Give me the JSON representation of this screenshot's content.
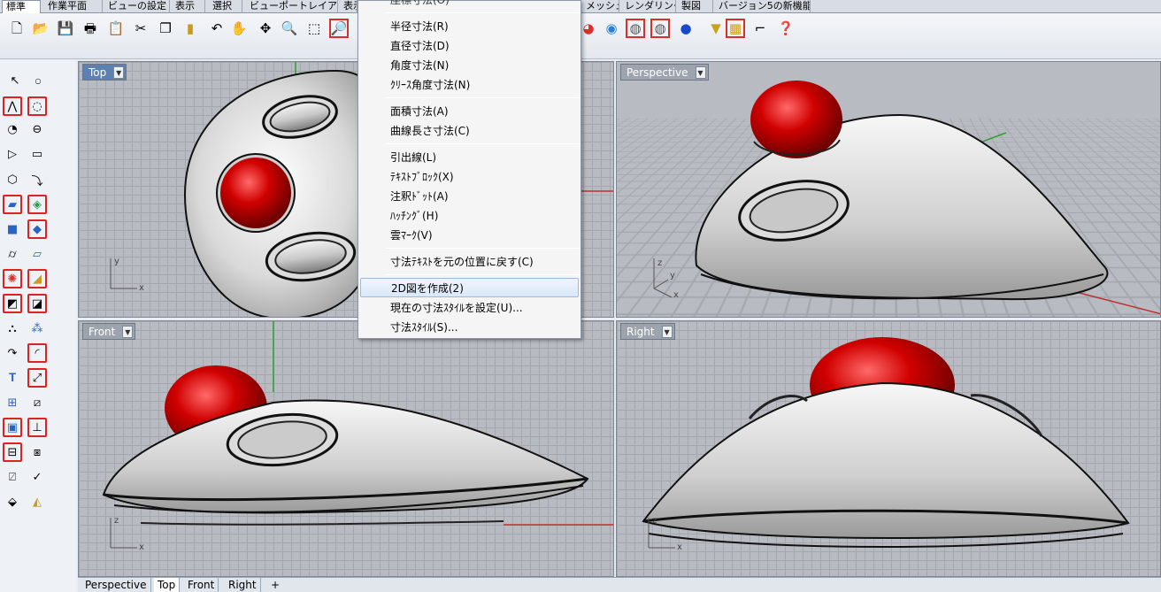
{
  "tabs": [
    "標準",
    "作業平面",
    "ビューの設定",
    "表示",
    "選択",
    "ビューポートレイアウト",
    "表示",
    "メッシュ",
    "レンダリング",
    "製図",
    "バージョン5の新機能"
  ],
  "active_tab": "標準",
  "toolbar_icons": [
    "new-file-icon",
    "open-folder-icon",
    "save-icon",
    "print-icon",
    "import-icon",
    "cut-icon",
    "copy-icon",
    "paste-icon",
    "undo-icon",
    "pan-hand-icon",
    "rotate-view-icon",
    "zoom-icon",
    "zoom-window-icon",
    "zoom-selected-icon"
  ],
  "toolbar_right_icons": [
    "render-ball-icon",
    "color-wheel-icon",
    "shaded-sphere-icon",
    "rendered-sphere-icon",
    "blue-sphere-icon",
    "light-icon",
    "grid-snap-icon",
    "osnap-icon",
    "help-icon"
  ],
  "menu": {
    "top_partial": "座標寸法(O)",
    "items": [
      {
        "label": "半径寸法(R)"
      },
      {
        "label": "直径寸法(D)"
      },
      {
        "label": "角度寸法(N)"
      },
      {
        "label": "ｸﾘｰｽ角度寸法(N)"
      },
      {
        "label": "面積寸法(A)"
      },
      {
        "label": "曲線長さ寸法(C)"
      },
      {
        "label": "引出線(L)"
      },
      {
        "label": "ﾃｷｽﾄﾌﾞﾛｯｸ(X)"
      },
      {
        "label": "注釈ﾄﾞｯﾄ(A)"
      },
      {
        "label": "ﾊｯﾁﾝｸﾞ(H)"
      },
      {
        "label": "雲ﾏｰｸ(V)"
      },
      {
        "label": "寸法ﾃｷｽﾄを元の位置に戻す(C)"
      },
      {
        "label": "2D図を作成(2)"
      },
      {
        "label": "現在の寸法ｽﾀｲﾙを設定(U)..."
      },
      {
        "label": "寸法ｽﾀｲﾙ(S)..."
      }
    ],
    "highlighted": "2D図を作成(2)"
  },
  "viewports": {
    "top": {
      "label": "Top",
      "active": true,
      "axes": [
        "y",
        "x"
      ]
    },
    "perspective": {
      "label": "Perspective",
      "active": false,
      "axes": [
        "z",
        "y",
        "x"
      ]
    },
    "front": {
      "label": "Front",
      "active": false,
      "axes": [
        "z",
        "x"
      ]
    },
    "right": {
      "label": "Right",
      "active": false,
      "axes": [
        "z",
        "x"
      ]
    }
  },
  "viewport_tabs": [
    "Perspective",
    "Top",
    "Front",
    "Right"
  ],
  "active_viewport_tab": "Top",
  "add_tab_symbol": "+",
  "colors": {
    "ball": "#c40000",
    "body": "#d4d4d4",
    "grid_bg": "#b8bcc2",
    "highlight": "#dbe8f8"
  }
}
